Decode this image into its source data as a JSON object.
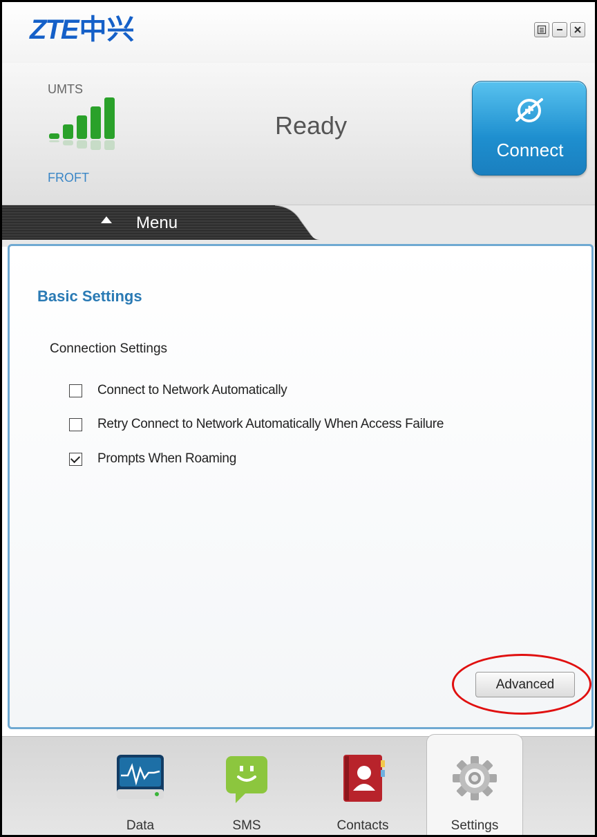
{
  "window": {
    "logo": {
      "latin": "ZTE",
      "chinese": "中兴"
    },
    "controls": [
      "menu-icon",
      "minimize-icon",
      "close-icon"
    ]
  },
  "status": {
    "network_type": "UMTS",
    "signal_bars": {
      "filled": 5,
      "total": 5
    },
    "operator": "FROFT",
    "connection_status": "Ready",
    "connect_button": "Connect"
  },
  "menu": {
    "label": "Menu"
  },
  "settings": {
    "section_title": "Basic Settings",
    "group_title": "Connection Settings",
    "options": [
      {
        "label": "Connect to Network Automatically",
        "checked": false
      },
      {
        "label": "Retry Connect to Network Automatically When Access Failure",
        "checked": false
      },
      {
        "label": "Prompts When Roaming",
        "checked": true
      }
    ],
    "advanced_button": "Advanced"
  },
  "dock": [
    {
      "label": "Data",
      "icon": "data-icon",
      "active": false
    },
    {
      "label": "SMS",
      "icon": "sms-icon",
      "active": false
    },
    {
      "label": "Contacts",
      "icon": "contacts-icon",
      "active": false
    },
    {
      "label": "Settings",
      "icon": "settings-gear-icon",
      "active": true
    }
  ],
  "colors": {
    "brand": "#1560c8",
    "accent": "#2a7ab4",
    "signal": "#2aa12a",
    "highlight": "#e01010"
  }
}
